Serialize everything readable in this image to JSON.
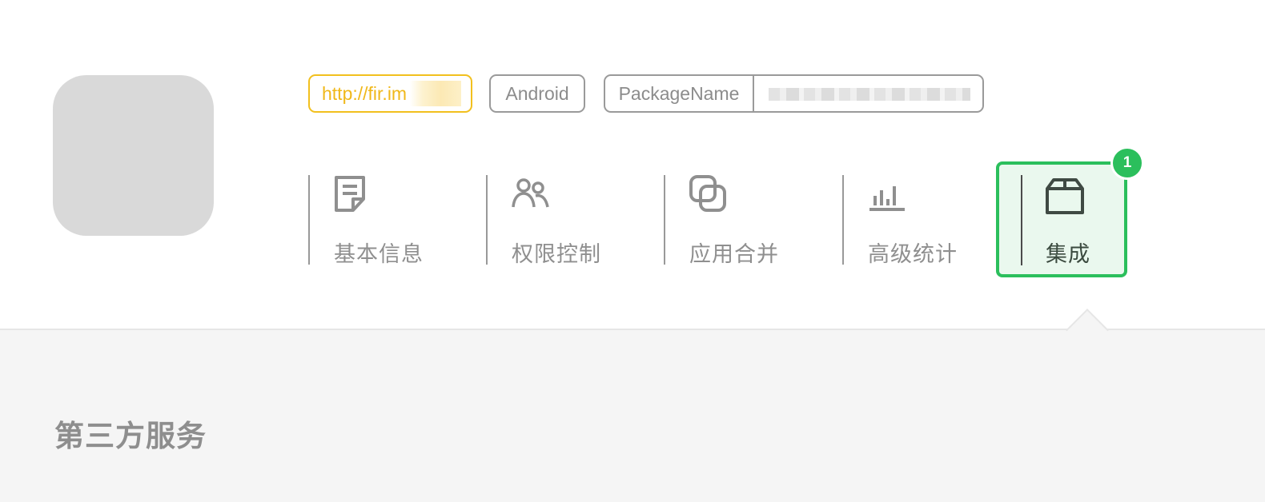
{
  "app": {
    "icon": "app-icon-placeholder"
  },
  "tags": {
    "url": "http://fir.im",
    "platform": "Android",
    "package_label": "PackageName",
    "package_value": ""
  },
  "nav": {
    "items": [
      {
        "label": "基本信息",
        "icon": "document-icon"
      },
      {
        "label": "权限控制",
        "icon": "users-icon"
      },
      {
        "label": "应用合并",
        "icon": "merge-icon"
      },
      {
        "label": "高级统计",
        "icon": "bar-chart-icon"
      },
      {
        "label": "集成",
        "icon": "box-icon"
      }
    ],
    "badge_count": "1",
    "active_color": "#2bbf5c"
  },
  "section": {
    "title": "第三方服务"
  },
  "colors": {
    "url_tag": "#f0b81a",
    "active_bg": "#eaf8ee",
    "lower_bg": "#f5f5f5"
  }
}
